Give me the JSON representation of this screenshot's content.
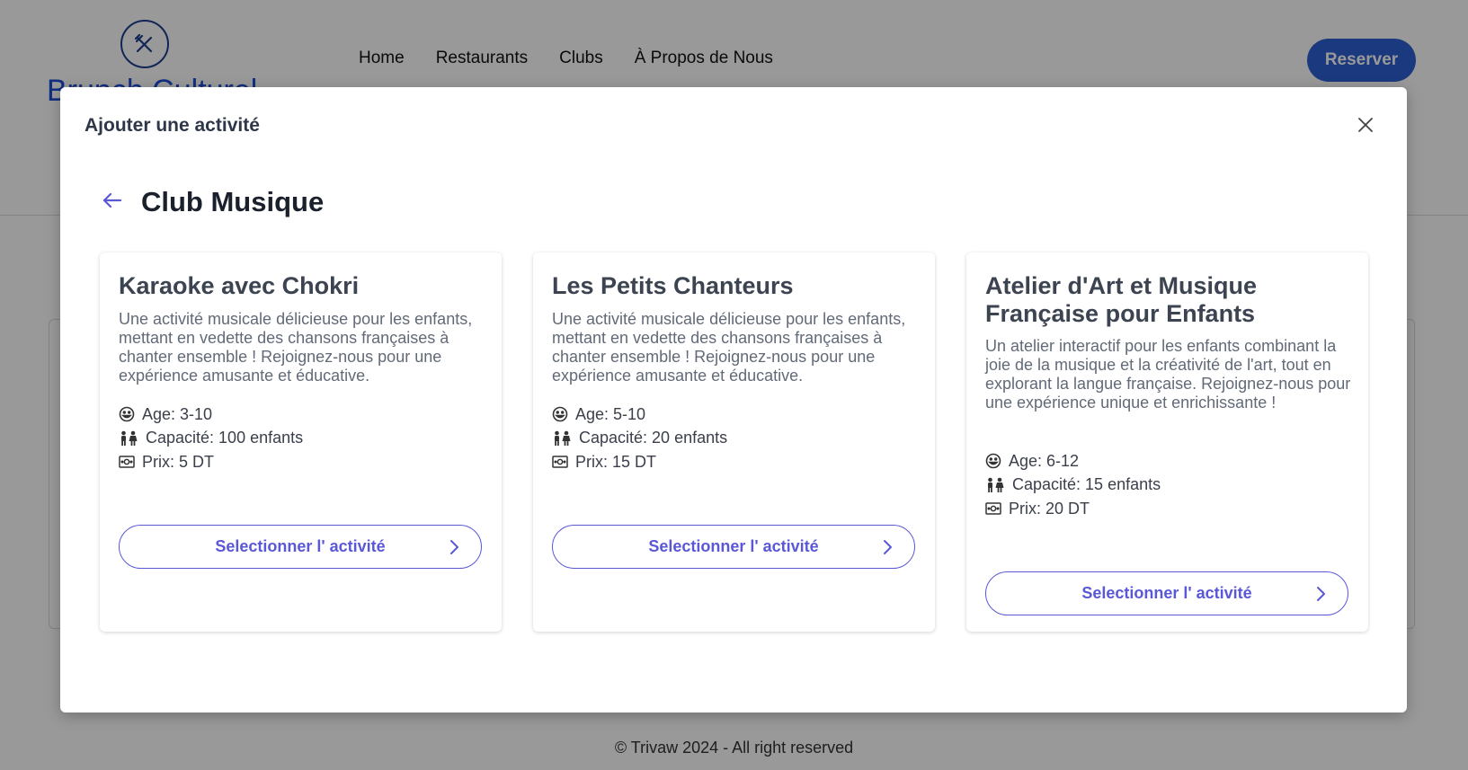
{
  "header": {
    "logo_text": "Brunch Culturel",
    "nav": [
      "Home",
      "Restaurants",
      "Clubs",
      "À Propos de Nous"
    ],
    "reserve_label": "Reserver"
  },
  "footer": {
    "text": "© Trivaw 2024 - All right reserved"
  },
  "modal": {
    "title": "Ajouter une activité",
    "club_title": "Club Musique",
    "cards": [
      {
        "title": "Karaoke avec Chokri",
        "description": "Une activité musicale délicieuse pour les enfants, mettant en vedette des chansons françaises à chanter ensemble ! Rejoignez-nous pour une expérience amusante et éducative.",
        "age": "Age: 3-10",
        "capacity": "Capacité: 100 enfants",
        "price": "Prix: 5 DT",
        "button": "Selectionner l' activité"
      },
      {
        "title": "Les Petits Chanteurs",
        "description": "Une activité musicale délicieuse pour les enfants, mettant en vedette des chansons françaises à chanter ensemble ! Rejoignez-nous pour une expérience amusante et éducative.",
        "age": "Age: 5-10",
        "capacity": "Capacité: 20 enfants",
        "price": "Prix: 15 DT",
        "button": "Selectionner l' activité"
      },
      {
        "title": "Atelier d'Art et Musique Française pour Enfants",
        "description": "Un atelier interactif pour les enfants combinant la joie de la musique et la créativité de l'art, tout en explorant la langue française. Rejoignez-nous pour une expérience unique et enrichissante !",
        "age": "Age: 6-12",
        "capacity": "Capacité: 15 enfants",
        "price": "Prix: 20 DT",
        "button": "Selectionner l' activité"
      }
    ]
  },
  "colors": {
    "accent": "#5a58d6",
    "brand": "#2d5fd3"
  },
  "icons": [
    "fork-knife-icon",
    "close-icon",
    "arrow-left-icon",
    "smile-icon",
    "people-icon",
    "money-icon",
    "chevron-right-icon"
  ]
}
